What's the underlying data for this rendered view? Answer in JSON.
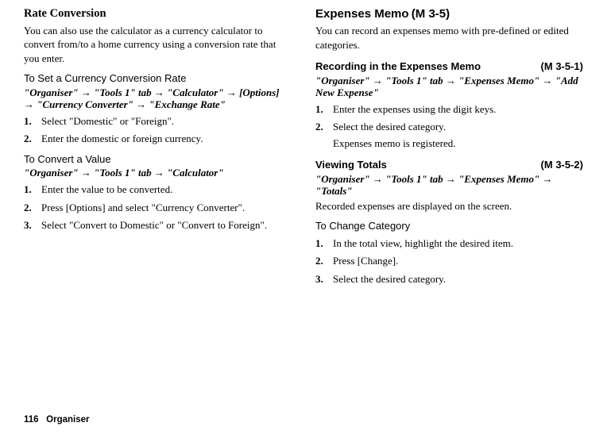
{
  "left": {
    "rateConversion": {
      "title": "Rate Conversion",
      "intro": "You can also use the calculator as a currency calculator to convert from/to a home currency using a conversion rate that you enter.",
      "setRate": {
        "heading": "To Set a Currency Conversion Rate",
        "path": "\"Organiser\" → \"Tools 1\" tab → \"Calculator\" → [Options] → \"Currency Converter\" → \"Exchange Rate\"",
        "steps": [
          "Select \"Domestic\" or \"Foreign\".",
          "Enter the domestic or foreign currency."
        ]
      },
      "convertValue": {
        "heading": "To Convert a Value",
        "path": "\"Organiser\" → \"Tools 1\" tab → \"Calculator\"",
        "steps": [
          "Enter the value to be converted.",
          "Press [Options] and select \"Currency Converter\".",
          "Select \"Convert to Domestic\" or \"Convert to Foreign\"."
        ]
      }
    }
  },
  "right": {
    "expensesMemo": {
      "title": "Expenses Memo",
      "mcode": "(M 3-5)",
      "intro": "You can record an expenses memo with pre-defined or edited categories.",
      "recording": {
        "heading": "Recording in the Expenses Memo",
        "mcode": "(M 3-5-1)",
        "path": "\"Organiser\" → \"Tools 1\" tab → \"Expenses Memo\" → \"Add New Expense\"",
        "steps": [
          "Enter the expenses using the digit keys.",
          "Select the desired category."
        ],
        "note": "Expenses memo is registered."
      },
      "viewingTotals": {
        "heading": "Viewing Totals",
        "mcode": "(M 3-5-2)",
        "path": "\"Organiser\" → \"Tools 1\" tab → \"Expenses Memo\" → \"Totals\"",
        "result": "Recorded expenses are displayed on the screen."
      },
      "changeCategory": {
        "heading": "To Change Category",
        "steps": [
          "In the total view, highlight the desired item.",
          "Press [Change].",
          "Select the desired category."
        ]
      }
    }
  },
  "footer": {
    "page": "116",
    "section": "Organiser"
  }
}
